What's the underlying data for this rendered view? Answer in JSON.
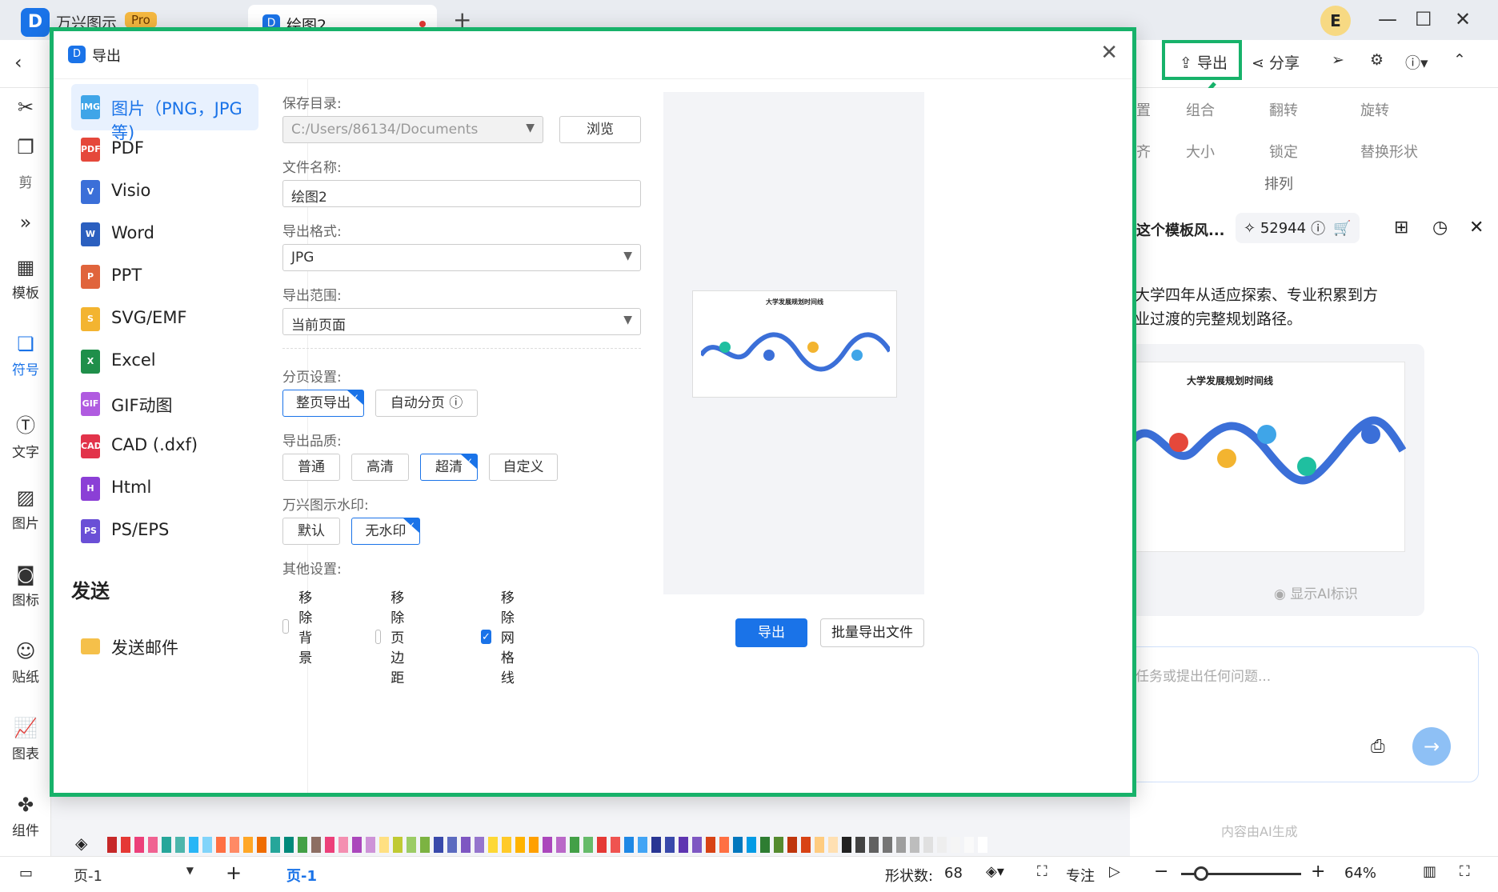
{
  "app": {
    "name": "万兴图示",
    "badge": "Pro",
    "logo": "D"
  },
  "tab": {
    "label": "绘图2"
  },
  "user": {
    "initial": "E"
  },
  "toolbar": {
    "export": "导出",
    "share": "分享"
  },
  "ribbon": {
    "r1": [
      "置",
      "组合",
      "翻转",
      "旋转"
    ],
    "r2": [
      "齐",
      "大小",
      "锁定",
      "替换形状"
    ],
    "group_label": "排列",
    "left_cut": "剪"
  },
  "left_panel": [
    "模板",
    "符号",
    "文字",
    "图片",
    "图标",
    "贴纸",
    "图表",
    "组件"
  ],
  "ai": {
    "title": "这个模板风...",
    "credits": "52944",
    "text_line1": "大学四年从适应探索、专业积累到方",
    "text_line2": "业过渡的完整规划路径。",
    "card_title": "大学发展规划时间线",
    "show_ai_label": "显示AI标识",
    "input_placeholder": "任务或提出任何问题...",
    "footer": "内容由AI生成"
  },
  "status": {
    "page_select": "页-1",
    "page_tab": "页-1",
    "shapes_label": "形状数:",
    "shapes_count": "68",
    "focus": "专注",
    "zoom": "64%"
  },
  "dialog": {
    "title": "导出",
    "formats": [
      {
        "label": "图片（PNG，JPG等)",
        "color": "#3fa5e8",
        "abbr": "IMG"
      },
      {
        "label": "PDF",
        "color": "#e5483b",
        "abbr": "PDF"
      },
      {
        "label": "Visio",
        "color": "#3b6fd8",
        "abbr": "V"
      },
      {
        "label": "Word",
        "color": "#2b5fbf",
        "abbr": "W"
      },
      {
        "label": "PPT",
        "color": "#e0643c",
        "abbr": "P"
      },
      {
        "label": "SVG/EMF",
        "color": "#f3b430",
        "abbr": "S"
      },
      {
        "label": "Excel",
        "color": "#1f8f4a",
        "abbr": "X"
      },
      {
        "label": "GIF动图",
        "color": "#b05be0",
        "abbr": "GIF"
      },
      {
        "label": "CAD (.dxf)",
        "color": "#e2334a",
        "abbr": "CAD"
      },
      {
        "label": "Html",
        "color": "#8b3fd6",
        "abbr": "H"
      },
      {
        "label": "PS/EPS",
        "color": "#6a4fd6",
        "abbr": "PS"
      }
    ],
    "send_heading": "发送",
    "send_email": "发送邮件",
    "save_dir_label": "保存目录:",
    "save_dir_value": "C:/Users/86134/Documents",
    "browse": "浏览",
    "filename_label": "文件名称:",
    "filename_value": "绘图2",
    "format_label": "导出格式:",
    "format_value": "JPG",
    "range_label": "导出范围:",
    "range_value": "当前页面",
    "paging_label": "分页设置:",
    "paging_full": "整页导出",
    "paging_auto": "自动分页",
    "quality_label": "导出品质:",
    "quality_options": [
      "普通",
      "高清",
      "超清",
      "自定义"
    ],
    "watermark_label": "万兴图示水印:",
    "watermark_default": "默认",
    "watermark_none": "无水印",
    "other_label": "其他设置:",
    "other_options": [
      {
        "label": "移除背景",
        "checked": false
      },
      {
        "label": "移除页边距",
        "checked": false
      },
      {
        "label": "移除网格线",
        "checked": true
      }
    ],
    "thumb_title": "大学发展规划时间线",
    "export_btn": "导出",
    "batch_btn": "批量导出文件"
  },
  "accent": "#1a73e8",
  "highlight": "#17b26a"
}
